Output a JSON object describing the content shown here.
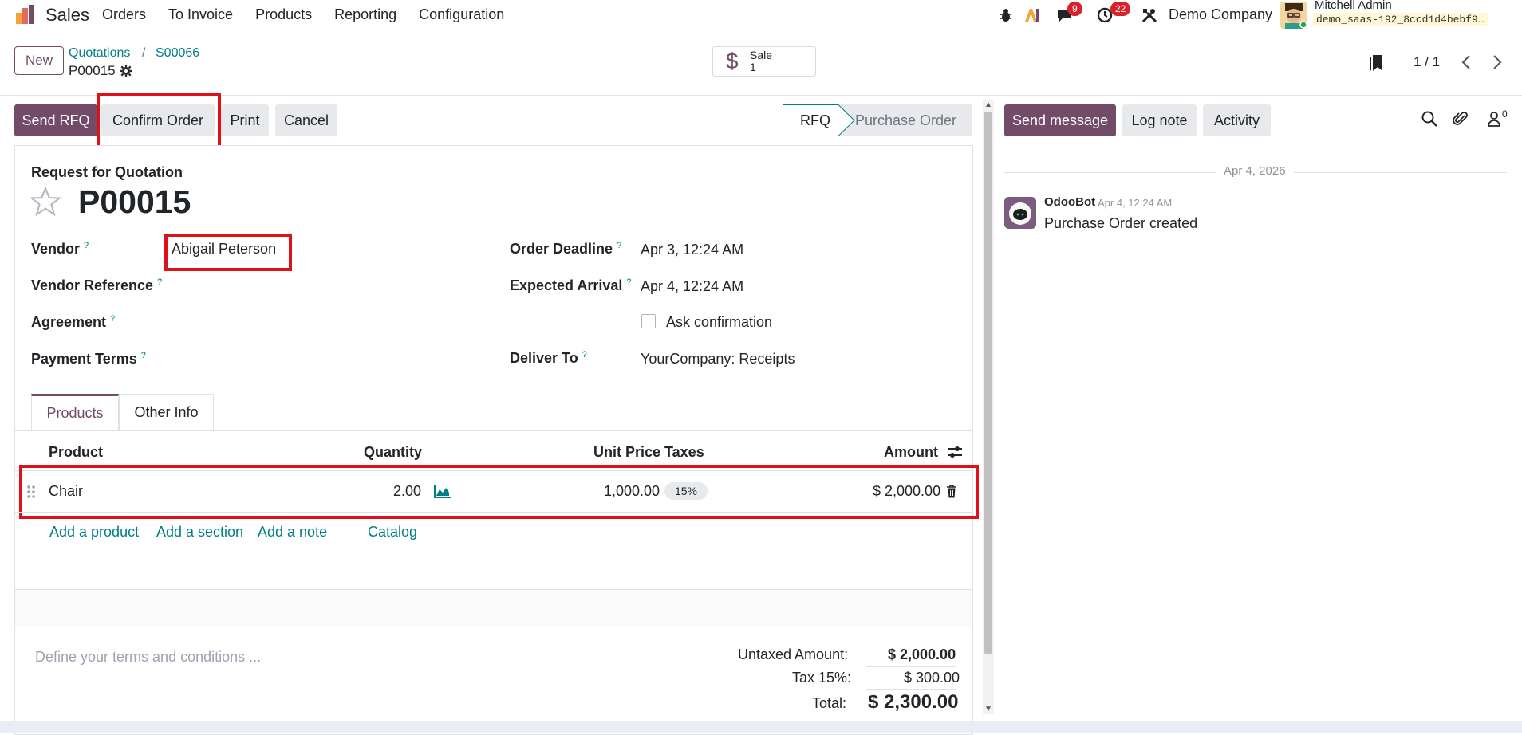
{
  "navbar": {
    "app_name": "Sales",
    "menu": [
      "Orders",
      "To Invoice",
      "Products",
      "Reporting",
      "Configuration"
    ],
    "messages_badge": "9",
    "activities_badge": "22",
    "company": "Demo Company",
    "user_name": "Mitchell Admin",
    "database": "demo_saas-192_8ccd1d4bebf9…"
  },
  "control": {
    "new_label": "New",
    "breadcrumb_root": "Quotations",
    "breadcrumb_sep": "/",
    "breadcrumb_mid": "S00066",
    "breadcrumb_current": "P00015",
    "smart_button": {
      "label": "Sale",
      "count": "1",
      "icon": "$"
    },
    "pager": "1 / 1"
  },
  "actions": {
    "send_rfq": "Send RFQ",
    "confirm_order": "Confirm Order",
    "print": "Print",
    "cancel": "Cancel",
    "status_rfq": "RFQ",
    "status_po": "Purchase Order"
  },
  "form": {
    "doc_type": "Request for Quotation",
    "doc_name": "P00015",
    "help_mark": "?",
    "vendor_label": "Vendor",
    "vendor_value": "Abigail Peterson",
    "vendor_ref_label": "Vendor Reference",
    "agreement_label": "Agreement",
    "payment_terms_label": "Payment Terms",
    "order_deadline_label": "Order Deadline",
    "order_deadline_value": "Apr 3, 12:24 AM",
    "expected_arrival_label": "Expected Arrival",
    "expected_arrival_value": "Apr 4, 12:24 AM",
    "ask_confirmation": "Ask confirmation",
    "deliver_to_label": "Deliver To",
    "deliver_to_value": "YourCompany: Receipts"
  },
  "tabs": [
    "Products",
    "Other Info"
  ],
  "lines": {
    "headers": {
      "product": "Product",
      "quantity": "Quantity",
      "unit_price": "Unit Price",
      "taxes": "Taxes",
      "amount": "Amount"
    },
    "rows": [
      {
        "product": "Chair",
        "quantity": "2.00",
        "unit_price": "1,000.00",
        "taxes": "15%",
        "amount": "$ 2,000.00"
      }
    ],
    "add_product": "Add a product",
    "add_section": "Add a section",
    "add_note": "Add a note",
    "catalog": "Catalog"
  },
  "totals": {
    "terms_placeholder": "Define your terms and conditions ...",
    "untaxed_label": "Untaxed Amount:",
    "untaxed_value": "$ 2,000.00",
    "tax_label": "Tax 15%:",
    "tax_value": "$ 300.00",
    "total_label": "Total:",
    "total_value": "$ 2,300.00"
  },
  "chatter": {
    "send_message": "Send message",
    "log_note": "Log note",
    "activity": "Activity",
    "followers_count": "0",
    "date": "Apr 4, 2026",
    "message": {
      "author": "OdooBot",
      "time": "Apr 4, 12:24 AM",
      "body": "Purchase Order created"
    }
  },
  "colors": {
    "primary": "#714b67",
    "link": "#017e84",
    "highlight": "#e0101a",
    "badge": "#d9212c"
  }
}
